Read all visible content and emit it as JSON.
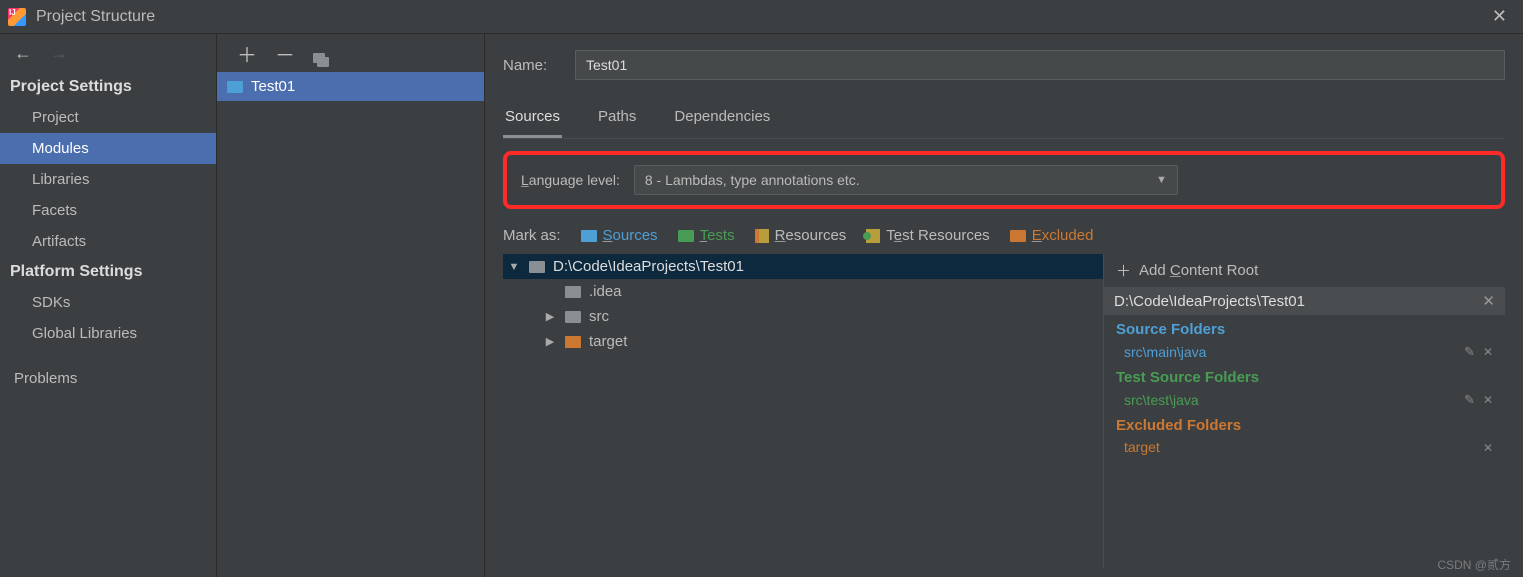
{
  "window": {
    "title": "Project Structure"
  },
  "sidebar": {
    "sections": [
      {
        "header": "Project Settings",
        "items": [
          "Project",
          "Modules",
          "Libraries",
          "Facets",
          "Artifacts"
        ],
        "selected": 1
      },
      {
        "header": "Platform Settings",
        "items": [
          "SDKs",
          "Global Libraries"
        ]
      },
      {
        "header": "",
        "items": [
          "Problems"
        ]
      }
    ]
  },
  "modules": {
    "selected": "Test01"
  },
  "detail": {
    "name_label": "Name:",
    "name_value": "Test01",
    "tabs": [
      "Sources",
      "Paths",
      "Dependencies"
    ],
    "active_tab": 0,
    "language_level_label": "Language level:",
    "language_level_value": "8 - Lambdas, type annotations etc.",
    "mark_as_label": "Mark as:",
    "mark_as": {
      "sources": "Sources",
      "tests": "Tests",
      "resources": "Resources",
      "test_resources": "Test Resources",
      "excluded": "Excluded"
    },
    "tree": {
      "root": "D:\\Code\\IdeaProjects\\Test01",
      "children": [
        {
          "name": ".idea",
          "expandable": false,
          "color": "grey"
        },
        {
          "name": "src",
          "expandable": true,
          "color": "grey"
        },
        {
          "name": "target",
          "expandable": true,
          "color": "orange"
        }
      ]
    },
    "content_root": {
      "add_label": "Add Content Root",
      "path": "D:\\Code\\IdeaProjects\\Test01",
      "groups": [
        {
          "title": "Source Folders",
          "color": "blue",
          "items": [
            "src\\main\\java"
          ],
          "editable": true
        },
        {
          "title": "Test Source Folders",
          "color": "green",
          "items": [
            "src\\test\\java"
          ],
          "editable": true
        },
        {
          "title": "Excluded Folders",
          "color": "orange",
          "items": [
            "target"
          ],
          "editable": false
        }
      ]
    }
  },
  "watermark": "CSDN @贰方"
}
